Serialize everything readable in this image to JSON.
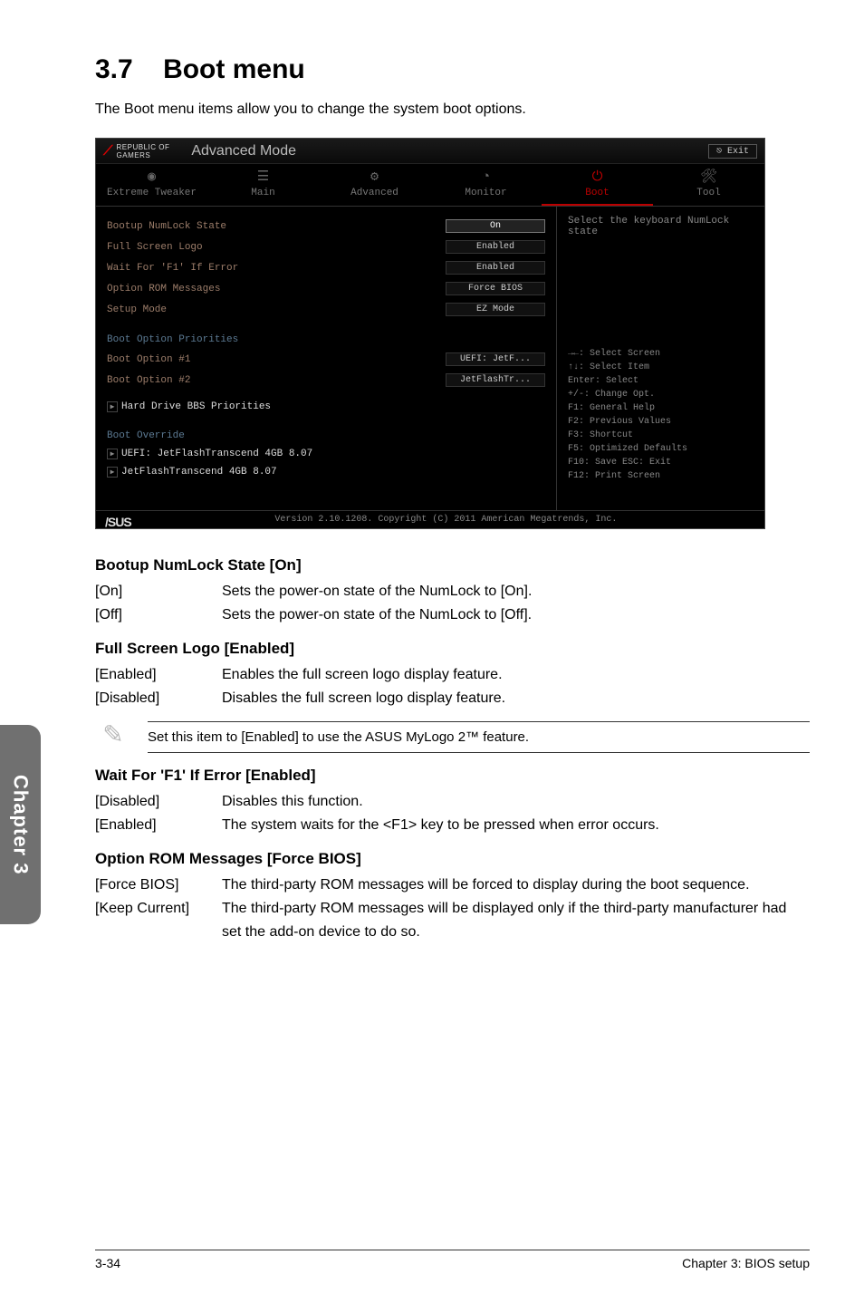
{
  "section": {
    "number": "3.7",
    "title": "Boot menu"
  },
  "intro": "The Boot menu items allow you to change the system boot options.",
  "bios": {
    "brand_top": "REPUBLIC OF",
    "brand_bottom": "GAMERS",
    "mode": "Advanced Mode",
    "exit": "Exit",
    "tabs": {
      "t0": "Extreme Tweaker",
      "t1": "Main",
      "t2": "Advanced",
      "t3": "Monitor",
      "t4": "Boot",
      "t5": "Tool"
    },
    "rows": {
      "r0_label": "Bootup NumLock State",
      "r0_val": "On",
      "r1_label": "Full Screen Logo",
      "r1_val": "Enabled",
      "r2_label": "Wait For 'F1' If Error",
      "r2_val": "Enabled",
      "r3_label": "Option ROM Messages",
      "r3_val": "Force BIOS",
      "r4_label": "Setup Mode",
      "r4_val": "EZ Mode"
    },
    "boot_priorities_head": "Boot Option Priorities",
    "boot_opt1_label": "Boot Option #1",
    "boot_opt1_val": "UEFI: JetF...",
    "boot_opt2_label": "Boot Option #2",
    "boot_opt2_val": "JetFlashTr...",
    "link_hdd": "Hard Drive BBS Priorities",
    "boot_override_head": "Boot Override",
    "link_uefi": "UEFI: JetFlashTranscend 4GB 8.07",
    "link_jet": "JetFlashTranscend 4GB 8.07",
    "sidebar_hint": "Select the keyboard NumLock state",
    "help": {
      "l1": "→←: Select Screen",
      "l2": "↑↓: Select Item",
      "l3": "Enter: Select",
      "l4": "+/-: Change Opt.",
      "l5": "F1: General Help",
      "l6": "F2: Previous Values",
      "l7": "F3: Shortcut",
      "l8": "F5: Optimized Defaults",
      "l9": "F10: Save  ESC: Exit",
      "l10": "F12: Print Screen"
    },
    "footer_brand": "/SUS",
    "footer_text": "Version 2.10.1208. Copyright (C) 2011 American Megatrends, Inc."
  },
  "doc": {
    "h1": "Bootup NumLock State [On]",
    "h1_o1_k": "[On]",
    "h1_o1_d": "Sets the power-on state of the NumLock to [On].",
    "h1_o2_k": "[Off]",
    "h1_o2_d": "Sets the power-on state of the NumLock to [Off].",
    "h2": "Full Screen Logo [Enabled]",
    "h2_o1_k": "[Enabled]",
    "h2_o1_d": "Enables the full screen logo display feature.",
    "h2_o2_k": "[Disabled]",
    "h2_o2_d": "Disables the full screen logo display feature.",
    "note": "Set this item to [Enabled] to use the ASUS MyLogo 2™ feature.",
    "h3": "Wait For 'F1' If Error [Enabled]",
    "h3_o1_k": "[Disabled]",
    "h3_o1_d": "Disables this function.",
    "h3_o2_k": "[Enabled]",
    "h3_o2_d": "The system waits for the <F1> key to be pressed when error occurs.",
    "h4": "Option ROM Messages [Force BIOS]",
    "h4_o1_k": "[Force BIOS]",
    "h4_o1_d": "The third-party ROM messages will be forced to display during the boot sequence.",
    "h4_o2_k": "[Keep Current]",
    "h4_o2_d": "The third-party ROM messages will be displayed only if the third-party manufacturer had set the add-on device to do so."
  },
  "sidetab": "Chapter 3",
  "footer_left": "3-34",
  "footer_right": "Chapter 3: BIOS setup"
}
